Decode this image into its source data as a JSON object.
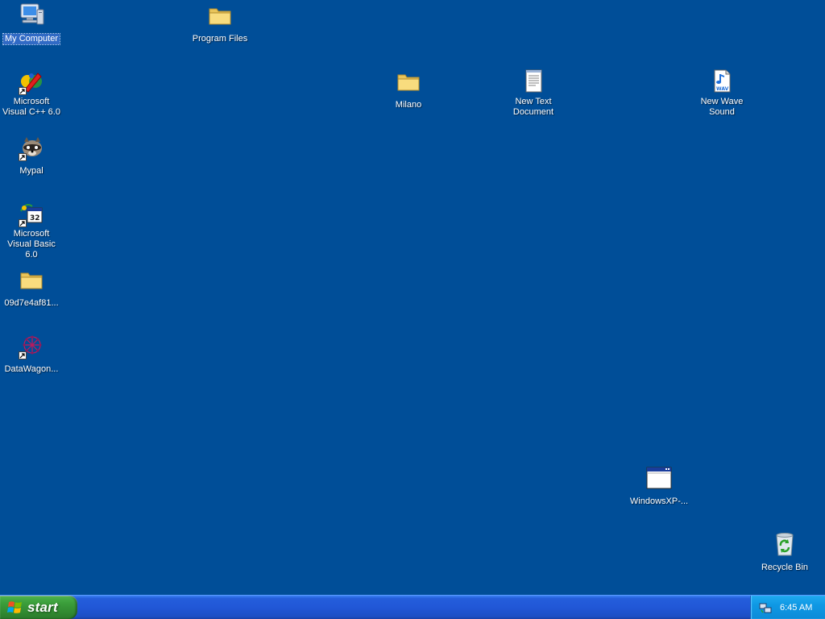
{
  "desktop": {
    "background_color": "#004e98",
    "icons": {
      "my_computer": {
        "label": "My Computer",
        "icon": "computer-icon"
      },
      "program_files": {
        "label": "Program Files",
        "icon": "folder-icon"
      },
      "msvc": {
        "label": "Microsoft Visual C++ 6.0",
        "icon": "visual-cpp-icon"
      },
      "milano": {
        "label": "Milano",
        "icon": "folder-icon"
      },
      "new_text": {
        "label": "New Text Document",
        "icon": "text-document-icon"
      },
      "new_wave": {
        "label": "New Wave Sound",
        "icon": "wav-file-icon"
      },
      "mypal": {
        "label": "Mypal",
        "icon": "raccoon-icon"
      },
      "msvb": {
        "label": "Microsoft Visual Basic 6.0",
        "icon": "visual-basic-icon"
      },
      "hash_folder": {
        "label": "09d7e4af81...",
        "icon": "folder-icon"
      },
      "datawagon": {
        "label": "DataWagon...",
        "icon": "datawagon-icon"
      },
      "winxp": {
        "label": "WindowsXP-...",
        "icon": "window-icon"
      },
      "recycle": {
        "label": "Recycle Bin",
        "icon": "recycle-bin-icon"
      }
    }
  },
  "taskbar": {
    "start_label": "start",
    "clock": "6:45 AM",
    "colors": {
      "start": "#3c9f3c",
      "bar": "#245edb",
      "tray": "#0f98e4"
    }
  }
}
